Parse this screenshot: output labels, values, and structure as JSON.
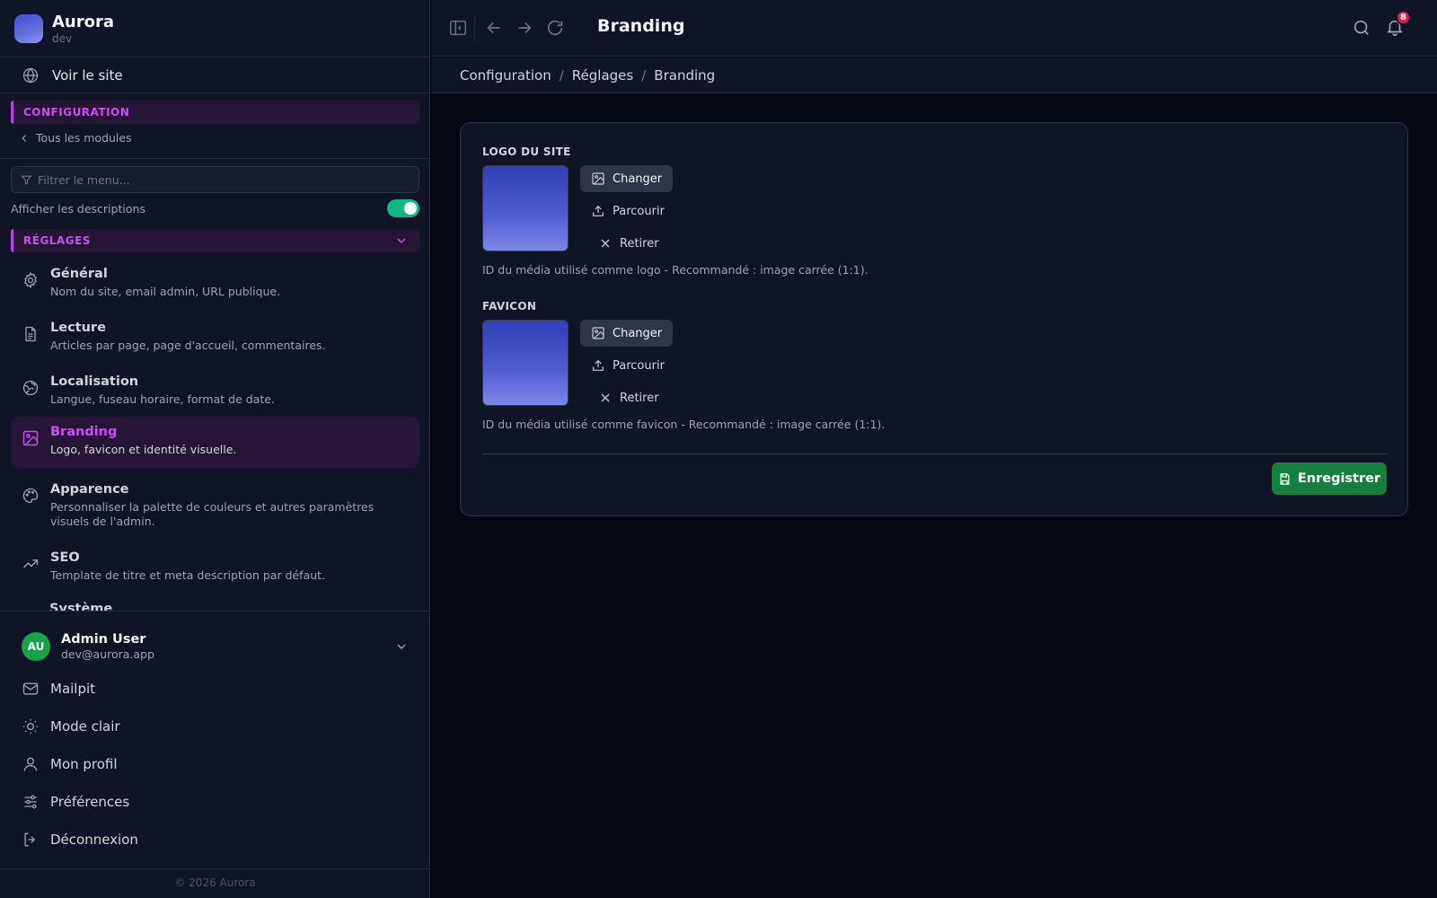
{
  "brand": {
    "name": "Aurora",
    "env": "dev"
  },
  "sidebar": {
    "view_site": "Voir le site",
    "configuration_header": "CONFIGURATION",
    "back_link": "Tous les modules",
    "filter_placeholder": "Filtrer le menu...",
    "show_descriptions_label": "Afficher les descriptions",
    "show_descriptions": true,
    "settings_header": "RÉGLAGES",
    "items": [
      {
        "title": "Général",
        "desc": "Nom du site, email admin, URL publique.",
        "icon": "gear-icon"
      },
      {
        "title": "Lecture",
        "desc": "Articles par page, page d'accueil, commentaires.",
        "icon": "document-icon"
      },
      {
        "title": "Localisation",
        "desc": "Langue, fuseau horaire, format de date.",
        "icon": "globe-icon"
      },
      {
        "title": "Branding",
        "desc": "Logo, favicon et identité visuelle.",
        "icon": "image-icon",
        "active": true
      },
      {
        "title": "Apparence",
        "desc": "Personnaliser la palette de couleurs et autres paramètres visuels de l'admin.",
        "icon": "palette-icon"
      },
      {
        "title": "SEO",
        "desc": "Template de titre et meta description par défaut.",
        "icon": "trending-icon"
      },
      {
        "title": "Système",
        "desc": ""
      }
    ],
    "user": {
      "initials": "AU",
      "name": "Admin User",
      "email": "dev@aurora.app"
    },
    "bottom_items": [
      {
        "label": "Mailpit",
        "icon": "mail-icon"
      },
      {
        "label": "Mode clair",
        "icon": "sun-icon"
      },
      {
        "label": "Mon profil",
        "icon": "user-icon"
      },
      {
        "label": "Préférences",
        "icon": "sliders-icon"
      },
      {
        "label": "Déconnexion",
        "icon": "logout-icon"
      }
    ],
    "copyright": "© 2026 Aurora"
  },
  "topbar": {
    "title": "Branding",
    "notifications": "8"
  },
  "breadcrumb": [
    "Configuration",
    "Réglages",
    "Branding"
  ],
  "branding": {
    "logo": {
      "label": "LOGO DU SITE",
      "help": "ID du média utilisé comme logo - Recommandé : image carrée (1:1)."
    },
    "favicon": {
      "label": "FAVICON",
      "help": "ID du média utilisé comme favicon - Recommandé : image carrée (1:1)."
    },
    "actions": {
      "change": "Changer",
      "browse": "Parcourir",
      "remove": "Retirer"
    },
    "save": "Enregistrer"
  },
  "colors": {
    "accent": "#c94ff3",
    "success": "#15803d",
    "toggle": "#10b981",
    "badge": "#e11d48"
  }
}
